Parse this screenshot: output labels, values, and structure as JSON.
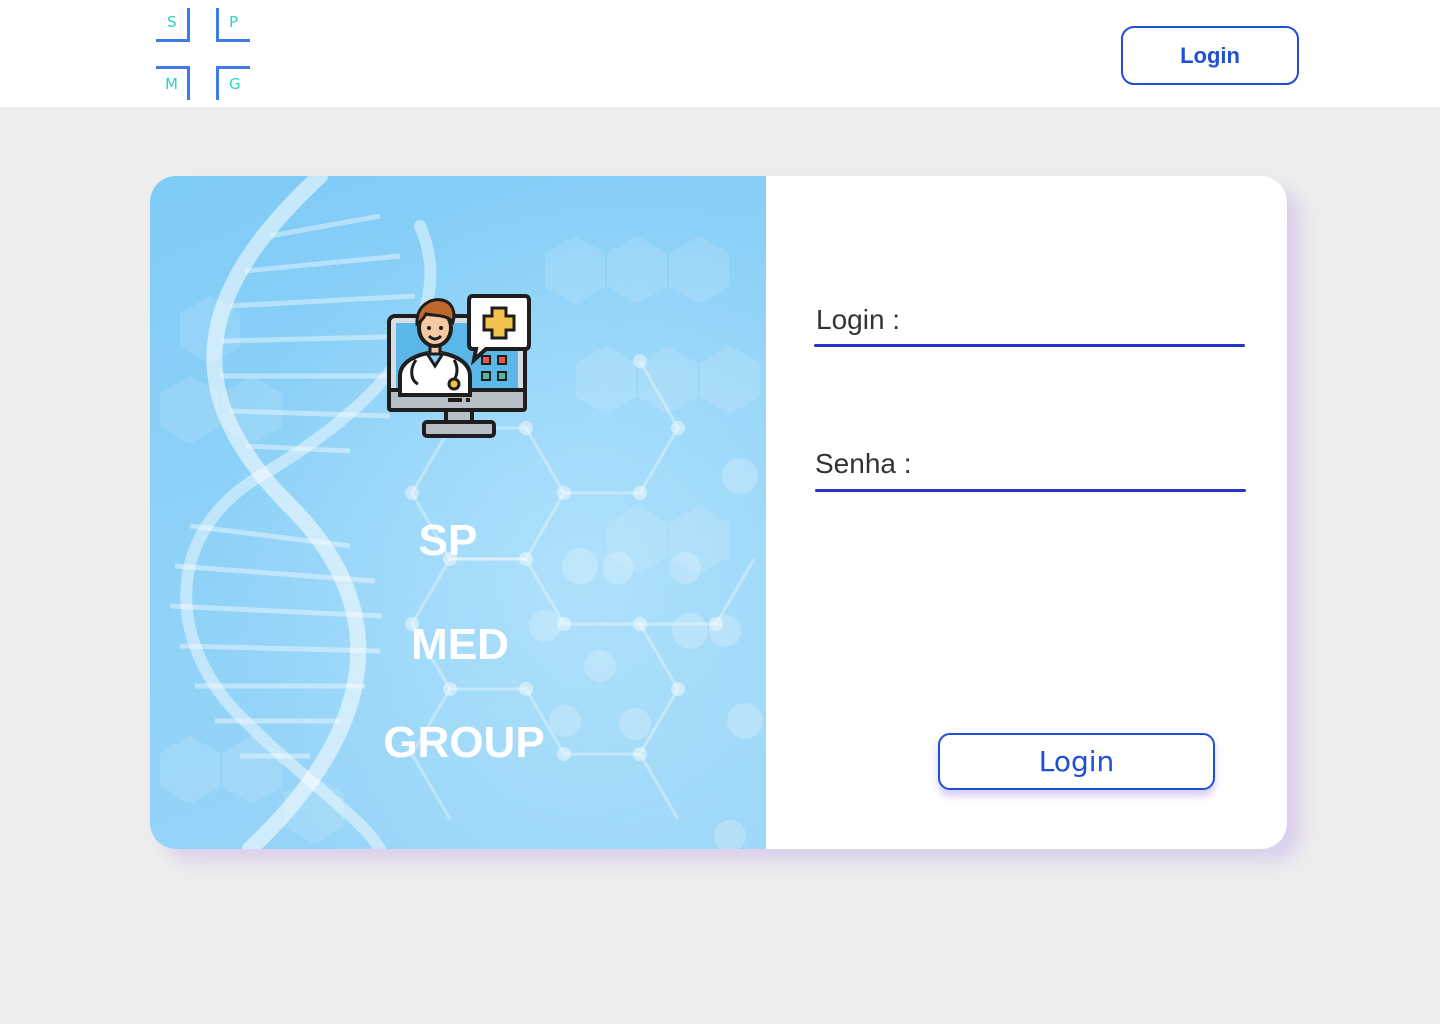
{
  "header": {
    "logo": {
      "letters": [
        "S",
        "P",
        "M",
        "G"
      ]
    },
    "login_button_label": "Login"
  },
  "hero": {
    "brand_lines": [
      "SP",
      "MED",
      "GROUP"
    ]
  },
  "form": {
    "login_label": "Login :",
    "login_value": "",
    "senha_label": "Senha :",
    "senha_value": "",
    "submit_label": "Login"
  },
  "colors": {
    "accent": "#1f4fd6",
    "underline": "#2a34c8",
    "logo_letters": "#2ed3c0",
    "logo_lines": "#3d7bea",
    "hero_bg": "#8fd2f8",
    "page_bg": "#eeeeee"
  },
  "icons": {
    "hero_icon": "doctor-telemedicine-icon"
  }
}
